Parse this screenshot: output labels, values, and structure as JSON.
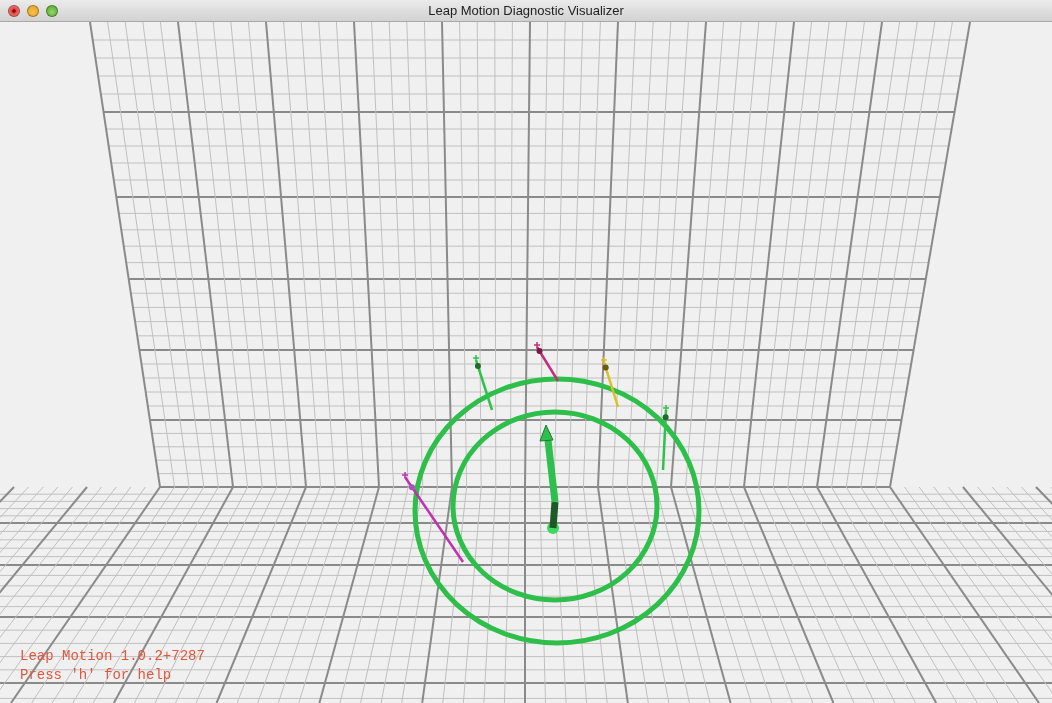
{
  "window": {
    "title": "Leap Motion Diagnostic Visualizer"
  },
  "overlay": {
    "version": "Leap Motion 1.0.2+7287",
    "help": "Press 'h' for help"
  }
}
